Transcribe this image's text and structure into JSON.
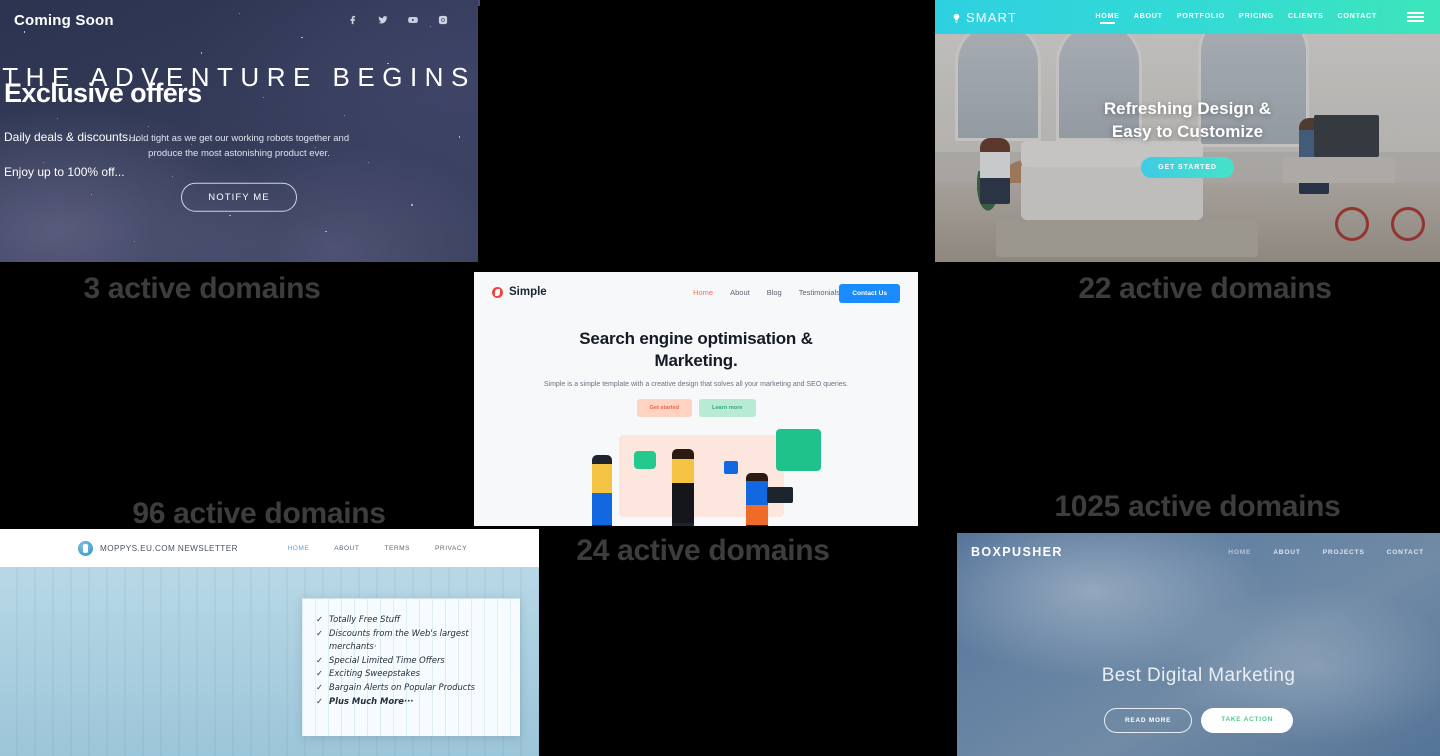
{
  "page": {
    "background_color": "#000000",
    "count_text_color": "#3d3d3d"
  },
  "cells": [
    {
      "id": "coming-soon",
      "count_label": "3 active domains"
    },
    {
      "id": "simple",
      "count_label": "24 active domains"
    },
    {
      "id": "smart",
      "count_label": "22 active domains"
    },
    {
      "id": "moppys",
      "count_label": "96 active domains"
    },
    {
      "id": "boxpusher",
      "count_label": "1025 active domains"
    }
  ],
  "coming_soon": {
    "logo": "Coming Soon",
    "social": [
      "facebook-icon",
      "twitter-icon",
      "youtube-icon",
      "instagram-icon"
    ],
    "headline": "THE ADVENTURE BEGINS",
    "subline_1": "Hold tight as we get our working robots together and",
    "subline_2": "produce the most astonishing product ever.",
    "button": "NOTIFY ME",
    "accent": "#ffffff",
    "bg_color": "#323a57"
  },
  "smart": {
    "logo": "SMART",
    "logo_icon": "lightbulb-icon",
    "nav": [
      "HOME",
      "ABOUT",
      "PORTFOLIO",
      "PRICING",
      "CLIENTS",
      "CONTACT"
    ],
    "active_nav": "HOME",
    "menu_icon": "hamburger-icon",
    "headline_1": "Refreshing Design &",
    "headline_2": "Easy to Customize",
    "button": "GET STARTED",
    "accent": "#33dbd4"
  },
  "simple": {
    "logo": "Simple",
    "logo_icon": "shutter-icon",
    "nav": [
      "Home",
      "About",
      "Blog",
      "Testimonials"
    ],
    "active_nav": "Home",
    "cta": "Contact Us",
    "headline_1": "Search engine optimisation &",
    "headline_2": "Marketing.",
    "subline": "Simple is a simple template with a creative design that solves all your marketing and SEO queries.",
    "button_primary": "Get started",
    "button_secondary": "Learn more",
    "accent": "#ff6b5e",
    "cta_color": "#1a8cff"
  },
  "moppys": {
    "logo": "MOPPYS.EU.COM  NEWSLETTER",
    "logo_icon": "circle-badge-icon",
    "nav": [
      "HOME",
      "ABOUT",
      "TERMS",
      "PRIVACY"
    ],
    "active_nav": "HOME",
    "headline": "Exclusive offers",
    "line_1": "Daily deals & discounts...",
    "line_2": "Enjoy up to 100% off...",
    "checklist": [
      "Totally Free Stuff",
      "Discounts from the Web's largest merchants·",
      "Special Limited Time Offers",
      "Exciting Sweepstakes",
      "Bargain Alerts on Popular Products",
      "Plus Much More···"
    ],
    "check_glyph": "✓",
    "accent": "#56a8d8"
  },
  "boxpusher": {
    "logo": "BOXPUSHER",
    "nav": [
      "HOME",
      "ABOUT",
      "PROJECTS",
      "CONTACT"
    ],
    "active_nav": "HOME",
    "headline": "Best Digital Marketing",
    "button_primary": "READ MORE",
    "button_secondary": "TAKE ACTION",
    "accent": "#4ec98a"
  }
}
